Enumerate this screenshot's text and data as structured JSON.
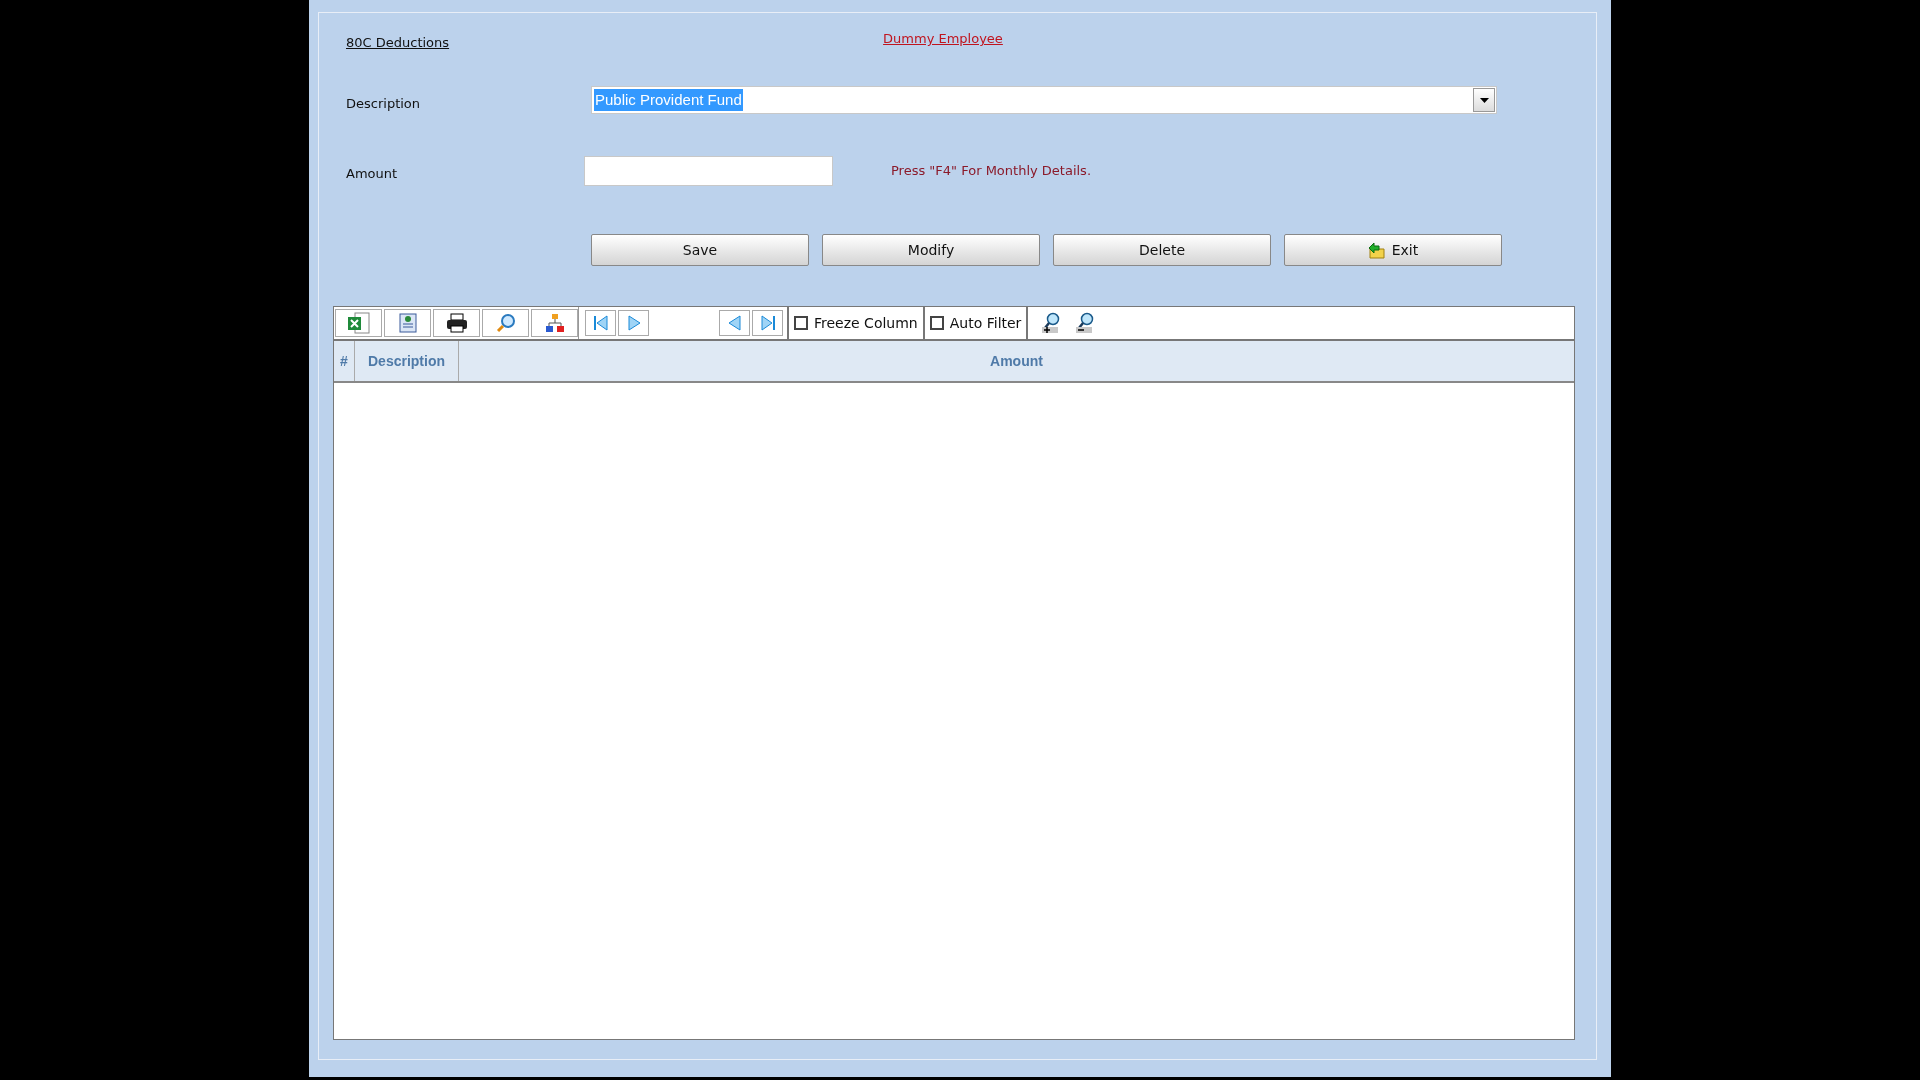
{
  "header": {
    "title": "80C Deductions",
    "employee": "Dummy Employee"
  },
  "form": {
    "description": {
      "label": "Description",
      "value": "Public Provident Fund",
      "selected": true
    },
    "amount": {
      "label": "Amount"
    },
    "hint": "Press \"F4\" For Monthly Details."
  },
  "buttons": [
    {
      "label": "Save",
      "kind": "plain"
    },
    {
      "label": "Modify",
      "kind": "plain"
    },
    {
      "label": "Delete",
      "kind": "plain"
    },
    {
      "label": "Exit",
      "kind": "exit"
    }
  ],
  "toolbar": {
    "tools": [
      {
        "kind": "excel"
      },
      {
        "kind": "html"
      },
      {
        "kind": "print"
      },
      {
        "kind": "find"
      },
      {
        "kind": "hierarchy"
      }
    ],
    "nav": [
      {
        "kind": "first"
      },
      {
        "kind": "next"
      },
      {
        "kind": "prev"
      },
      {
        "kind": "last"
      }
    ],
    "checkboxes": [
      {
        "label": "Freeze Column",
        "checked": false
      },
      {
        "label": "Auto Filter",
        "checked": false
      }
    ],
    "zoom": [
      {
        "kind": "zoom_in"
      },
      {
        "kind": "zoom_out"
      }
    ]
  },
  "table": {
    "columns": [
      "#",
      "Description",
      "Amount"
    ]
  }
}
